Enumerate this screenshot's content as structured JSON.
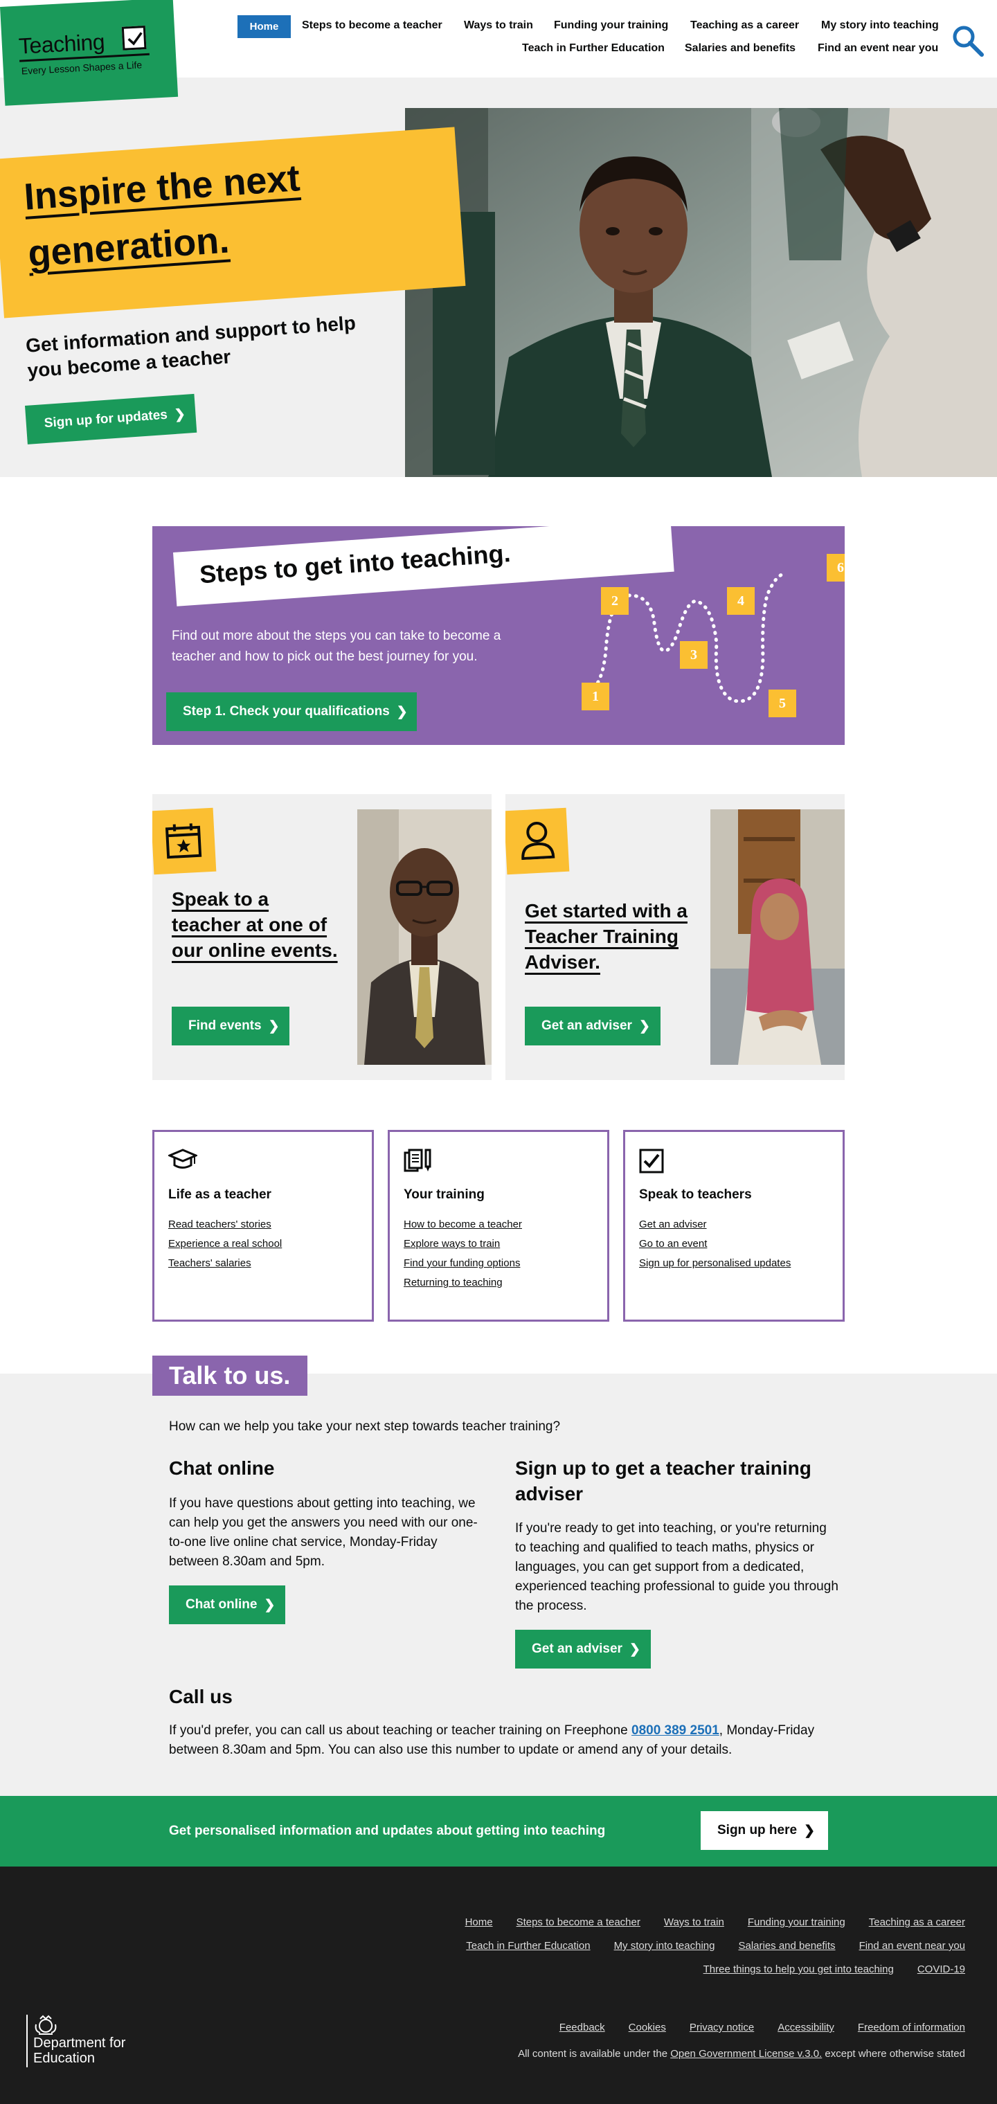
{
  "header": {
    "logo_word": "Teaching",
    "logo_tagline": "Every Lesson Shapes a Life",
    "nav_row1": [
      "Home",
      "Steps to become a teacher",
      "Ways to train",
      "Funding your training",
      "Teaching as a career",
      "My story into teaching"
    ],
    "nav_row2": [
      "Teach in Further Education",
      "Salaries and benefits",
      "Find an event near you"
    ],
    "search_icon": "search-icon"
  },
  "hero": {
    "title": "Inspire the next generation.",
    "title_line1": "Inspire the next",
    "title_line2": "generation.",
    "subtitle": "Get information and support to help you become a teacher",
    "button": "Sign up for updates"
  },
  "steps": {
    "title": "Steps to get into teaching.",
    "text": "Find out more about the steps you can take to become a teacher and how to pick out the best journey for you.",
    "button": "Step 1. Check your qualifications",
    "numbers": [
      "1",
      "2",
      "3",
      "4",
      "5",
      "6"
    ]
  },
  "cards": [
    {
      "title": "Speak to a teacher at one of our online events.",
      "button": "Find events",
      "icon": "calendar-star-icon"
    },
    {
      "title": "Get started with a Teacher Training Adviser.",
      "button": "Get an adviser",
      "icon": "person-icon"
    }
  ],
  "link_boxes": [
    {
      "title": "Life as a teacher",
      "icon": "graduation-cap-icon",
      "links": [
        "Read teachers' stories",
        "Experience a real school",
        "Teachers' salaries"
      ]
    },
    {
      "title": "Your training",
      "icon": "documents-pen-icon",
      "links": [
        "How to become a teacher",
        "Explore ways to train",
        "Find your funding options",
        "Returning to teaching"
      ]
    },
    {
      "title": "Speak to teachers",
      "icon": "checkbox-icon",
      "links": [
        "Get an adviser",
        "Go to an event",
        "Sign up for personalised updates"
      ]
    }
  ],
  "talk": {
    "tag": "Talk to us.",
    "intro": "How can we help you take your next step towards teacher training?",
    "chat_title": "Chat online",
    "chat_text": "If you have questions about getting into teaching, we can help you get the answers you need with our one-to-one live online chat service, Monday-Friday between 8.30am and 5pm.",
    "chat_button": "Chat online",
    "adviser_title": "Sign up to get a teacher training adviser",
    "adviser_text": "If you're ready to get into teaching, or you're returning to teaching and qualified to teach maths, physics or languages, you can get support from a dedicated, experienced teaching professional to guide you through the process.",
    "adviser_button": "Get an adviser",
    "call_title": "Call us",
    "call_text_before": "If you'd prefer, you can call us about teaching or teacher training on Freephone ",
    "call_phone": "0800 389 2501",
    "call_text_after": ", Monday-Friday between 8.30am and 5pm. You can also use this number to update or amend any of your details."
  },
  "banner": {
    "text": "Get personalised information and updates about getting into teaching",
    "button": "Sign up here"
  },
  "footer": {
    "row1": [
      "Home",
      "Steps to become a teacher",
      "Ways to train",
      "Funding your training",
      "Teaching as a career"
    ],
    "row2": [
      "Teach in Further Education",
      "My story into teaching",
      "Salaries and benefits",
      "Find an event near you"
    ],
    "row3": [
      "Three things to help you get into teaching",
      "COVID-19"
    ],
    "row4": [
      "Feedback",
      "Cookies",
      "Privacy notice",
      "Accessibility",
      "Freedom of information"
    ],
    "dfe_name": "Department for Education",
    "license_before": "All content is available under the ",
    "license_link": "Open Government License v.3.0.",
    "license_after": " except where otherwise stated"
  },
  "colors": {
    "green": "#1a9a5a",
    "yellow": "#fbbf32",
    "purple": "#8a65ad",
    "blue": "#1d70b8",
    "grey_bg": "#f0f0f0",
    "footer_bg": "#1c1c1c"
  }
}
